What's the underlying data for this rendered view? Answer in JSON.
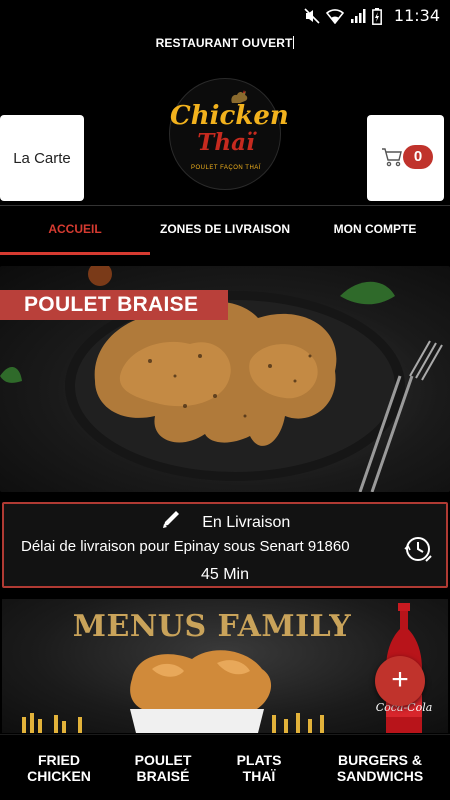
{
  "status_bar": {
    "time": "11:34"
  },
  "header": {
    "restaurant_status": "RESTAURANT OUVERT",
    "carte_label": "La Carte",
    "cart_count": "0",
    "logo": {
      "word1": "Chicken",
      "word2": "Thaï",
      "tagline": "POULET FAÇON THAÏ"
    }
  },
  "nav_tabs": [
    {
      "label": "ACCUEIL",
      "active": true
    },
    {
      "label": "ZONES DE LIVRAISON",
      "active": false
    },
    {
      "label": "MON COMPTE",
      "active": false
    }
  ],
  "hero": {
    "banner": "POULET BRAISE"
  },
  "delivery": {
    "mode": "En Livraison",
    "delay_text": "Délai de livraison pour Epinay sous Senart 91860",
    "duration": "45 Min"
  },
  "promo": {
    "title": "MENUS FAMILY",
    "bottle_label": "Coca-Cola"
  },
  "fab": {
    "label": "+"
  },
  "bottom_nav": [
    {
      "label": "FRIED\nCHICKEN"
    },
    {
      "label": "POULET\nBRAISÉ"
    },
    {
      "label": "PLATS\nTHAÏ"
    },
    {
      "label": "BURGERS &\nSANDWICHS"
    }
  ],
  "colors": {
    "accent": "#d63b31",
    "banner": "#b9403a",
    "gold": "#f2b21d",
    "background": "#000000"
  }
}
